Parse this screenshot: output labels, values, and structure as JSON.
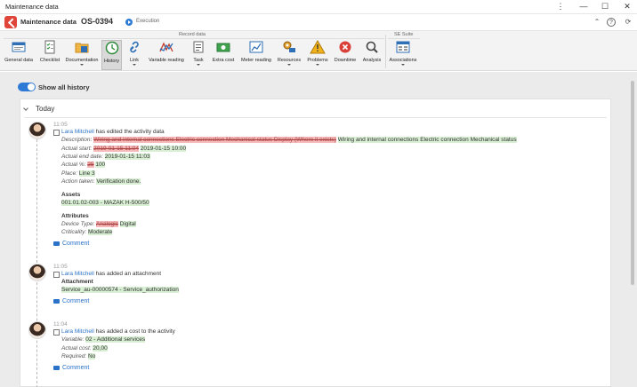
{
  "window": {
    "title": "Maintenance data",
    "controls": [
      "⋮",
      "—",
      "☐",
      "✕"
    ]
  },
  "header": {
    "module": "Maintenance data",
    "separator": "›",
    "record_id": "OS-0394",
    "status": "Execution"
  },
  "ribbon": {
    "group_record": "Record data",
    "group_se": "SE Suite",
    "buttons": [
      {
        "label": "General data",
        "icon": "general-data-icon"
      },
      {
        "label": "Checklist",
        "icon": "checklist-icon"
      },
      {
        "label": "Documentation",
        "icon": "documentation-icon"
      },
      {
        "label": "History",
        "icon": "history-icon"
      },
      {
        "label": "Link",
        "icon": "link-icon"
      },
      {
        "label": "Variable reading",
        "icon": "variable-reading-icon"
      },
      {
        "label": "Task",
        "icon": "task-icon"
      },
      {
        "label": "Extra cost",
        "icon": "extra-cost-icon"
      },
      {
        "label": "Meter reading",
        "icon": "meter-reading-icon"
      },
      {
        "label": "Resources",
        "icon": "resources-icon"
      },
      {
        "label": "Problems",
        "icon": "problems-icon"
      },
      {
        "label": "Downtime",
        "icon": "downtime-icon"
      },
      {
        "label": "Analysis",
        "icon": "analysis-icon"
      },
      {
        "label": "Associations",
        "icon": "associations-icon"
      }
    ]
  },
  "content": {
    "toggle_label": "Show all history",
    "section_title": "Today",
    "comment_label": "Comment",
    "entries": [
      {
        "time": "11:05",
        "user": "Lara Mitchell",
        "action": " has edited the activity data",
        "fields": [
          {
            "label": "Description:",
            "old": "Wiring and internal connections Electric connection Mechanical status Display (Where it exists)",
            "new": "Wiring and internal connections Electric connection Mechanical status"
          },
          {
            "label": "Actual start:",
            "old": "2019-01-15 11:04",
            "new": "2019-01-15 10:00"
          },
          {
            "label": "Actual end date:",
            "old": "",
            "new": "2019-01-15 11:03"
          },
          {
            "label": "Actual %:",
            "old": "25",
            "new": "100"
          },
          {
            "label": "Place:",
            "old": "",
            "new": "Line 3"
          },
          {
            "label": "Action taken:",
            "old": "",
            "new": "Verification done."
          }
        ],
        "assets_title": "Assets",
        "asset": "001.01.02-003 - MAZAK H-500/50",
        "attributes_title": "Attributes",
        "attributes": [
          {
            "label": "Device Type:",
            "old": "Analogic",
            "new": "Digital"
          },
          {
            "label": "Criticality:",
            "old": "",
            "new": "Moderate"
          }
        ]
      },
      {
        "time": "11:05",
        "user": "Lara Mitchell",
        "action": " has added an attachment",
        "section": "Attachment",
        "value": "Service_au-00000574 - Service_authorization"
      },
      {
        "time": "11:04",
        "user": "Lara Mitchell",
        "action": " has added a cost to the activity",
        "fields": [
          {
            "label": "Variable:",
            "new": "02 - Additional services"
          },
          {
            "label": "Actual cost:",
            "new": "20,00"
          },
          {
            "label": "Required:",
            "new": "No"
          }
        ]
      }
    ]
  }
}
